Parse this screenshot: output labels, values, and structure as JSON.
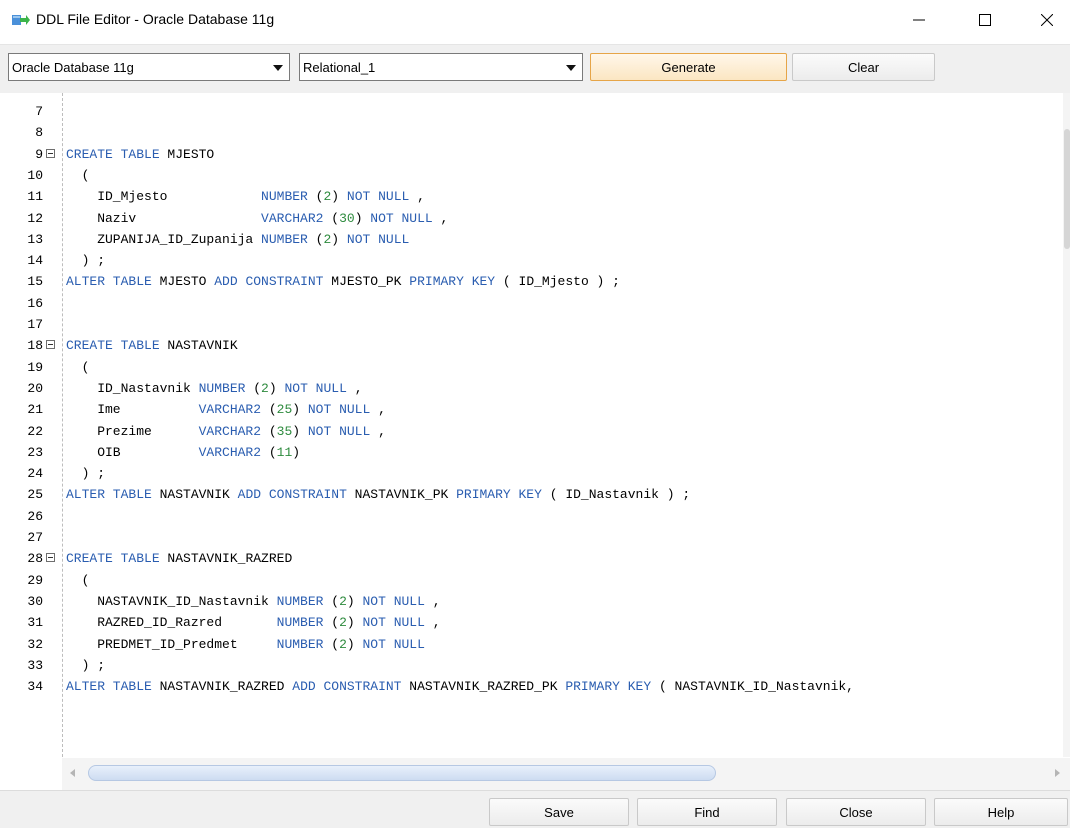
{
  "window": {
    "title": "DDL File Editor - Oracle Database 11g",
    "icon": "ddl-editor-app-icon",
    "controls": [
      "minimize-icon",
      "maximize-icon",
      "close-icon"
    ]
  },
  "toolbar": {
    "database_select": "Oracle Database 11g",
    "model_select": "Relational_1",
    "generate_label": "Generate",
    "clear_label": "Clear"
  },
  "editor": {
    "lines": [
      {
        "n": "7",
        "fold": false,
        "tokens": []
      },
      {
        "n": "8",
        "fold": false,
        "tokens": []
      },
      {
        "n": "9",
        "fold": true,
        "tokens": [
          [
            "kw",
            "CREATE TABLE"
          ],
          [
            "t",
            " MJESTO"
          ]
        ]
      },
      {
        "n": "10",
        "fold": false,
        "tokens": [
          [
            "t",
            "  ("
          ]
        ]
      },
      {
        "n": "11",
        "fold": false,
        "tokens": [
          [
            "t",
            "    ID_Mjesto            "
          ],
          [
            "kw",
            "NUMBER"
          ],
          [
            "t",
            " ("
          ],
          [
            "num",
            "2"
          ],
          [
            "t",
            ") "
          ],
          [
            "kw",
            "NOT NULL"
          ],
          [
            "t",
            " ,"
          ]
        ]
      },
      {
        "n": "12",
        "fold": false,
        "tokens": [
          [
            "t",
            "    Naziv                "
          ],
          [
            "kw",
            "VARCHAR2"
          ],
          [
            "t",
            " ("
          ],
          [
            "num",
            "30"
          ],
          [
            "t",
            ") "
          ],
          [
            "kw",
            "NOT NULL"
          ],
          [
            "t",
            " ,"
          ]
        ]
      },
      {
        "n": "13",
        "fold": false,
        "tokens": [
          [
            "t",
            "    ZUPANIJA_ID_Zupanija "
          ],
          [
            "kw",
            "NUMBER"
          ],
          [
            "t",
            " ("
          ],
          [
            "num",
            "2"
          ],
          [
            "t",
            ") "
          ],
          [
            "kw",
            "NOT NULL"
          ]
        ]
      },
      {
        "n": "14",
        "fold": false,
        "tokens": [
          [
            "t",
            "  ) ;"
          ]
        ]
      },
      {
        "n": "15",
        "fold": false,
        "tokens": [
          [
            "kw",
            "ALTER TABLE"
          ],
          [
            "t",
            " MJESTO "
          ],
          [
            "kw",
            "ADD CONSTRAINT"
          ],
          [
            "t",
            " MJESTO_PK "
          ],
          [
            "kw",
            "PRIMARY KEY"
          ],
          [
            "t",
            " ( ID_Mjesto ) ;"
          ]
        ]
      },
      {
        "n": "16",
        "fold": false,
        "tokens": []
      },
      {
        "n": "17",
        "fold": false,
        "tokens": []
      },
      {
        "n": "18",
        "fold": true,
        "tokens": [
          [
            "kw",
            "CREATE TABLE"
          ],
          [
            "t",
            " NASTAVNIK"
          ]
        ]
      },
      {
        "n": "19",
        "fold": false,
        "tokens": [
          [
            "t",
            "  ("
          ]
        ]
      },
      {
        "n": "20",
        "fold": false,
        "tokens": [
          [
            "t",
            "    ID_Nastavnik "
          ],
          [
            "kw",
            "NUMBER"
          ],
          [
            "t",
            " ("
          ],
          [
            "num",
            "2"
          ],
          [
            "t",
            ") "
          ],
          [
            "kw",
            "NOT NULL"
          ],
          [
            "t",
            " ,"
          ]
        ]
      },
      {
        "n": "21",
        "fold": false,
        "tokens": [
          [
            "t",
            "    Ime          "
          ],
          [
            "kw",
            "VARCHAR2"
          ],
          [
            "t",
            " ("
          ],
          [
            "num",
            "25"
          ],
          [
            "t",
            ") "
          ],
          [
            "kw",
            "NOT NULL"
          ],
          [
            "t",
            " ,"
          ]
        ]
      },
      {
        "n": "22",
        "fold": false,
        "tokens": [
          [
            "t",
            "    Prezime      "
          ],
          [
            "kw",
            "VARCHAR2"
          ],
          [
            "t",
            " ("
          ],
          [
            "num",
            "35"
          ],
          [
            "t",
            ") "
          ],
          [
            "kw",
            "NOT NULL"
          ],
          [
            "t",
            " ,"
          ]
        ]
      },
      {
        "n": "23",
        "fold": false,
        "tokens": [
          [
            "t",
            "    OIB          "
          ],
          [
            "kw",
            "VARCHAR2"
          ],
          [
            "t",
            " ("
          ],
          [
            "num",
            "11"
          ],
          [
            "t",
            ")"
          ]
        ]
      },
      {
        "n": "24",
        "fold": false,
        "tokens": [
          [
            "t",
            "  ) ;"
          ]
        ]
      },
      {
        "n": "25",
        "fold": false,
        "tokens": [
          [
            "kw",
            "ALTER TABLE"
          ],
          [
            "t",
            " NASTAVNIK "
          ],
          [
            "kw",
            "ADD CONSTRAINT"
          ],
          [
            "t",
            " NASTAVNIK_PK "
          ],
          [
            "kw",
            "PRIMARY KEY"
          ],
          [
            "t",
            " ( ID_Nastavnik ) ;"
          ]
        ]
      },
      {
        "n": "26",
        "fold": false,
        "tokens": []
      },
      {
        "n": "27",
        "fold": false,
        "tokens": []
      },
      {
        "n": "28",
        "fold": true,
        "tokens": [
          [
            "kw",
            "CREATE TABLE"
          ],
          [
            "t",
            " NASTAVNIK_RAZRED"
          ]
        ]
      },
      {
        "n": "29",
        "fold": false,
        "tokens": [
          [
            "t",
            "  ("
          ]
        ]
      },
      {
        "n": "30",
        "fold": false,
        "tokens": [
          [
            "t",
            "    NASTAVNIK_ID_Nastavnik "
          ],
          [
            "kw",
            "NUMBER"
          ],
          [
            "t",
            " ("
          ],
          [
            "num",
            "2"
          ],
          [
            "t",
            ") "
          ],
          [
            "kw",
            "NOT NULL"
          ],
          [
            "t",
            " ,"
          ]
        ]
      },
      {
        "n": "31",
        "fold": false,
        "tokens": [
          [
            "t",
            "    RAZRED_ID_Razred       "
          ],
          [
            "kw",
            "NUMBER"
          ],
          [
            "t",
            " ("
          ],
          [
            "num",
            "2"
          ],
          [
            "t",
            ") "
          ],
          [
            "kw",
            "NOT NULL"
          ],
          [
            "t",
            " ,"
          ]
        ]
      },
      {
        "n": "32",
        "fold": false,
        "tokens": [
          [
            "t",
            "    PREDMET_ID_Predmet     "
          ],
          [
            "kw",
            "NUMBER"
          ],
          [
            "t",
            " ("
          ],
          [
            "num",
            "2"
          ],
          [
            "t",
            ") "
          ],
          [
            "kw",
            "NOT NULL"
          ]
        ]
      },
      {
        "n": "33",
        "fold": false,
        "tokens": [
          [
            "t",
            "  ) ;"
          ]
        ]
      },
      {
        "n": "34",
        "fold": false,
        "tokens": [
          [
            "kw",
            "ALTER TABLE"
          ],
          [
            "t",
            " NASTAVNIK_RAZRED "
          ],
          [
            "kw",
            "ADD CONSTRAINT"
          ],
          [
            "t",
            " NASTAVNIK_RAZRED_PK "
          ],
          [
            "kw",
            "PRIMARY KEY"
          ],
          [
            "t",
            " ( NASTAVNIK_ID_Nastavnik,"
          ]
        ]
      }
    ]
  },
  "bottom": {
    "save_label": "Save",
    "find_label": "Find",
    "close_label": "Close",
    "help_label": "Help"
  },
  "colors": {
    "keyword": "#2a5db0",
    "number": "#2e8b3e",
    "generate_border": "#e6a548"
  }
}
